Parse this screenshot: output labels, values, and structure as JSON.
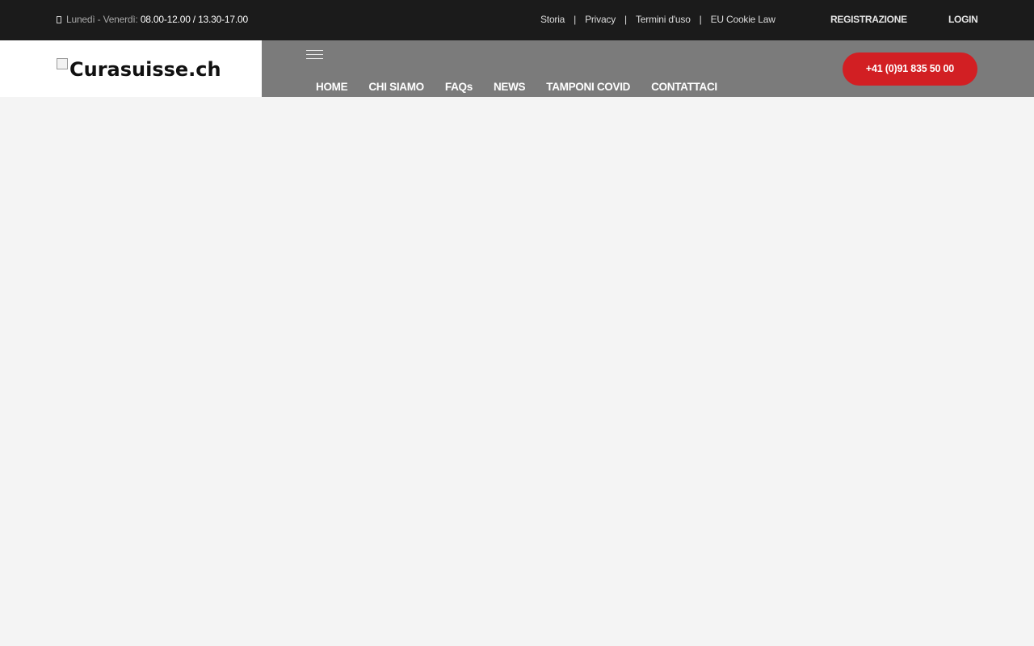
{
  "topbar": {
    "hours_icon": "clock-icon",
    "hours_label": "Lunedì - Venerdì:",
    "hours_value": "08.00-12.00 / 13.30-17.00",
    "links": [
      "Storia",
      "Privacy",
      "Termini d'uso",
      "EU Cookie Law"
    ],
    "separator": "|",
    "register_label": "REGISTRAZIONE",
    "login_label": "LOGIN"
  },
  "header": {
    "logo_alt": "Curasuisse.ch",
    "menu_icon": "hamburger-menu-icon",
    "nav": [
      "HOME",
      "CHI SIAMO",
      "FAQs",
      "NEWS",
      "TAMPONI COVID",
      "CONTATTACI"
    ],
    "phone_label": "+41 (0)91 835 50 00"
  },
  "colors": {
    "topbar_bg": "#1b1b1b",
    "nav_bg": "#7b7b7b",
    "accent": "#d21f23",
    "page_bg": "#f4f4f4"
  }
}
